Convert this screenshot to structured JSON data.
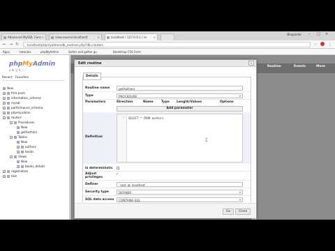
{
  "browser": {
    "tabs": [
      {
        "label": "Advanced MySQL Conc"
      },
      {
        "label": "view-source:localhost/"
      },
      {
        "label": "localhost / 127.0.0.1 / ro"
      },
      {
        "label": ""
      }
    ],
    "user": "Bhupinder",
    "url": "localhost/phpmyadmin/db_routines.php?db=routers",
    "bookmarks": [
      "Apps",
      "tutorials",
      "phpMyAdmin",
      "Setter and getter gu",
      "Bootstrap CSS Form"
    ]
  },
  "sidebar": {
    "logo_php": "php",
    "logo_my": "My",
    "logo_admin": "Admin",
    "recent": "Recent",
    "favorites": "Favorites",
    "tree": [
      {
        "label": "New",
        "indent": 1,
        "type": "new"
      },
      {
        "label": "firm-push",
        "indent": 1,
        "type": "db"
      },
      {
        "label": "information_schema",
        "indent": 1,
        "type": "db"
      },
      {
        "label": "mysql",
        "indent": 1,
        "type": "db"
      },
      {
        "label": "performance_schema",
        "indent": 1,
        "type": "db"
      },
      {
        "label": "phpmyadmin",
        "indent": 1,
        "type": "db"
      },
      {
        "label": "routers",
        "indent": 1,
        "type": "db"
      },
      {
        "label": "Procedures",
        "indent": 2,
        "type": "folder"
      },
      {
        "label": "New",
        "indent": 3,
        "type": "new"
      },
      {
        "label": "getAuthors",
        "indent": 3,
        "type": "item"
      },
      {
        "label": "Tables",
        "indent": 2,
        "type": "folder"
      },
      {
        "label": "New",
        "indent": 3,
        "type": "new"
      },
      {
        "label": "authors",
        "indent": 3,
        "type": "item"
      },
      {
        "label": "books",
        "indent": 3,
        "type": "item"
      },
      {
        "label": "Views",
        "indent": 2,
        "type": "folder"
      },
      {
        "label": "New",
        "indent": 3,
        "type": "new"
      },
      {
        "label": "books_details",
        "indent": 3,
        "type": "item"
      },
      {
        "label": "registration",
        "indent": 1,
        "type": "db"
      },
      {
        "label": "test",
        "indent": 1,
        "type": "db"
      }
    ]
  },
  "top_tabs": [
    "Routine",
    "Events",
    "More"
  ],
  "dialog": {
    "title": "Edit routine",
    "close": "×",
    "legend": "Details",
    "routine_name_label": "Routine name",
    "routine_name": "getAuthors",
    "type_label": "Type",
    "type": "PROCEDURE",
    "parameters_label": "Parameters",
    "param_headers": [
      "Direction",
      "Name",
      "Type",
      "Length/Values",
      "Options"
    ],
    "add_parameter": "Add parameter",
    "definition_label": "Definition",
    "definition_code": "SELECT * FROM authors",
    "line_number": "1",
    "deterministic_label": "Is deterministic",
    "adjust_label": "Adjust privileges",
    "definer_label": "Definer",
    "definer": "`root`@`localhost`",
    "security_label": "Security type",
    "security": "DEFINER",
    "sql_data_label": "SQL data access",
    "sql_data": "CONTAINS SQL",
    "go": "Go",
    "close_btn": "Close"
  }
}
